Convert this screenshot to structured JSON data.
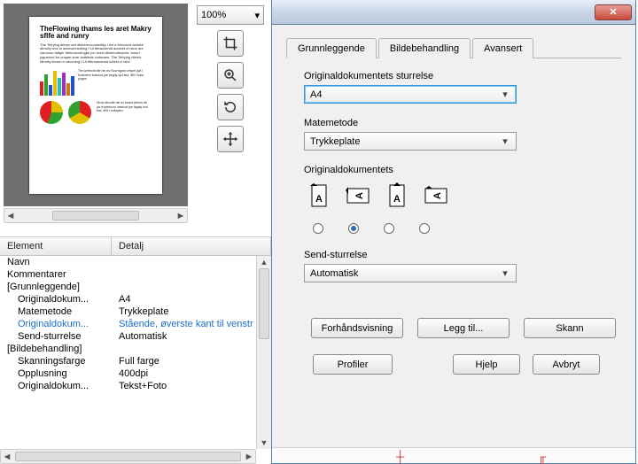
{
  "zoom": "100%",
  "table": {
    "headers": {
      "c1": "Element",
      "c2": "Detalj"
    },
    "rows": [
      {
        "c1": "Navn",
        "c2": "",
        "indent": false
      },
      {
        "c1": "Kommentarer",
        "c2": "",
        "indent": false
      },
      {
        "c1": "[Grunnleggende]",
        "c2": "",
        "indent": false
      },
      {
        "c1": "Originaldokum...",
        "c2": "A4",
        "indent": true
      },
      {
        "c1": "Matemetode",
        "c2": "Trykkeplate",
        "indent": true
      },
      {
        "c1": "Originaldokum...",
        "c2": "Stående, øverste kant til venstr",
        "indent": true,
        "highlight": true
      },
      {
        "c1": "Send-sturrelse",
        "c2": "Automatisk",
        "indent": true
      },
      {
        "c1": "[Bildebehandling]",
        "c2": "",
        "indent": false
      },
      {
        "c1": "Skanningsfarge",
        "c2": "Full farge",
        "indent": true
      },
      {
        "c1": "Opplusning",
        "c2": "400dpi",
        "indent": true
      },
      {
        "c1": "Originaldokum...",
        "c2": "Tekst+Foto",
        "indent": true
      }
    ]
  },
  "dialog": {
    "tabs": {
      "t1": "Grunnleggende",
      "t2": "Bildebehandling",
      "t3": "Avansert"
    },
    "orig_size_label": "Originaldokumentets sturrelse",
    "orig_size_value": "A4",
    "feed_label": "Matemetode",
    "feed_value": "Trykkeplate",
    "orient_label": "Originaldokumentets",
    "send_label": "Send-sturrelse",
    "send_value": "Automatisk",
    "btn_preview": "Forhåndsvisning",
    "btn_add": "Legg til...",
    "btn_scan": "Skann",
    "btn_profiles": "Profiler",
    "btn_help": "Hjelp",
    "btn_cancel": "Avbryt"
  },
  "preview": {
    "heading": "TheFlowing thams les aret Makry sflfe and runry"
  }
}
